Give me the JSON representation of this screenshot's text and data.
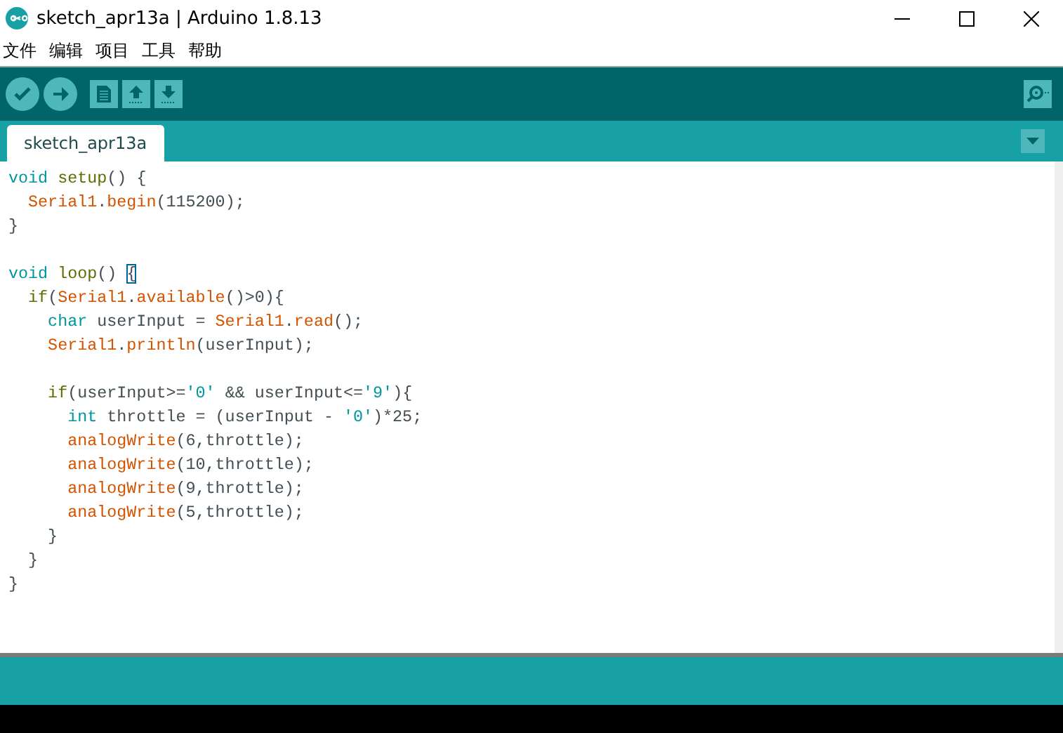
{
  "window": {
    "title": "sketch_apr13a | Arduino 1.8.13"
  },
  "menu": [
    "文件",
    "编辑",
    "项目",
    "工具",
    "帮助"
  ],
  "toolbar": [
    {
      "kind": "verify"
    },
    {
      "kind": "upload"
    },
    {
      "kind": "new"
    },
    {
      "kind": "open"
    },
    {
      "kind": "save"
    }
  ],
  "tabs": [
    {
      "label": "sketch_apr13a",
      "selected": true
    }
  ],
  "editor": {
    "lines": [
      {
        "kind": "code",
        "tokens": [
          {
            "kind": "type",
            "text": "void"
          },
          {
            "kind": "structure",
            "text": " setup"
          },
          {
            "kind": "plain",
            "text": "() {"
          }
        ]
      },
      {
        "kind": "code",
        "tokens": [
          {
            "kind": "function",
            "text": "  Serial1"
          },
          {
            "kind": "plain",
            "text": "."
          },
          {
            "kind": "function",
            "text": "begin"
          },
          {
            "kind": "plain",
            "text": "(115200);"
          }
        ]
      },
      {
        "kind": "code",
        "tokens": [
          {
            "kind": "plain",
            "text": "}"
          }
        ]
      },
      {
        "kind": "blank"
      },
      {
        "kind": "code",
        "tokens": [
          {
            "kind": "type",
            "text": "void"
          },
          {
            "kind": "structure",
            "text": " loop"
          },
          {
            "kind": "plain",
            "text": "() "
          },
          {
            "kind": "bracket",
            "text": "{"
          }
        ]
      },
      {
        "kind": "code",
        "tokens": [
          {
            "kind": "structure",
            "text": "  if"
          },
          {
            "kind": "plain",
            "text": "("
          },
          {
            "kind": "function",
            "text": "Serial1"
          },
          {
            "kind": "plain",
            "text": "."
          },
          {
            "kind": "function",
            "text": "available"
          },
          {
            "kind": "plain",
            "text": "()>0){"
          }
        ]
      },
      {
        "kind": "code",
        "tokens": [
          {
            "kind": "type",
            "text": "    char"
          },
          {
            "kind": "plain",
            "text": " userInput = "
          },
          {
            "kind": "function",
            "text": "Serial1"
          },
          {
            "kind": "plain",
            "text": "."
          },
          {
            "kind": "function",
            "text": "read"
          },
          {
            "kind": "plain",
            "text": "();"
          }
        ]
      },
      {
        "kind": "code",
        "tokens": [
          {
            "kind": "function",
            "text": "    Serial1"
          },
          {
            "kind": "plain",
            "text": "."
          },
          {
            "kind": "function",
            "text": "println"
          },
          {
            "kind": "plain",
            "text": "(userInput);"
          }
        ]
      },
      {
        "kind": "blank"
      },
      {
        "kind": "code",
        "tokens": [
          {
            "kind": "structure",
            "text": "    if"
          },
          {
            "kind": "plain",
            "text": "(userInput>="
          },
          {
            "kind": "literal",
            "text": "'0'"
          },
          {
            "kind": "plain",
            "text": " && userInput<="
          },
          {
            "kind": "literal",
            "text": "'9'"
          },
          {
            "kind": "plain",
            "text": "){"
          }
        ]
      },
      {
        "kind": "code",
        "tokens": [
          {
            "kind": "type",
            "text": "      int"
          },
          {
            "kind": "plain",
            "text": " throttle = (userInput - "
          },
          {
            "kind": "literal",
            "text": "'0'"
          },
          {
            "kind": "plain",
            "text": ")*25;"
          }
        ]
      },
      {
        "kind": "code",
        "tokens": [
          {
            "kind": "function",
            "text": "      analogWrite"
          },
          {
            "kind": "plain",
            "text": "(6,throttle);"
          }
        ]
      },
      {
        "kind": "code",
        "tokens": [
          {
            "kind": "function",
            "text": "      analogWrite"
          },
          {
            "kind": "plain",
            "text": "(10,throttle);"
          }
        ]
      },
      {
        "kind": "code",
        "tokens": [
          {
            "kind": "function",
            "text": "      analogWrite"
          },
          {
            "kind": "plain",
            "text": "(9,throttle);"
          }
        ]
      },
      {
        "kind": "code",
        "tokens": [
          {
            "kind": "function",
            "text": "      analogWrite"
          },
          {
            "kind": "plain",
            "text": "(5,throttle);"
          }
        ]
      },
      {
        "kind": "code",
        "tokens": [
          {
            "kind": "plain",
            "text": "    }"
          }
        ]
      },
      {
        "kind": "code",
        "tokens": [
          {
            "kind": "plain",
            "text": "  }"
          }
        ]
      },
      {
        "kind": "code",
        "tokens": [
          {
            "kind": "plain",
            "text": "}"
          }
        ]
      }
    ]
  }
}
